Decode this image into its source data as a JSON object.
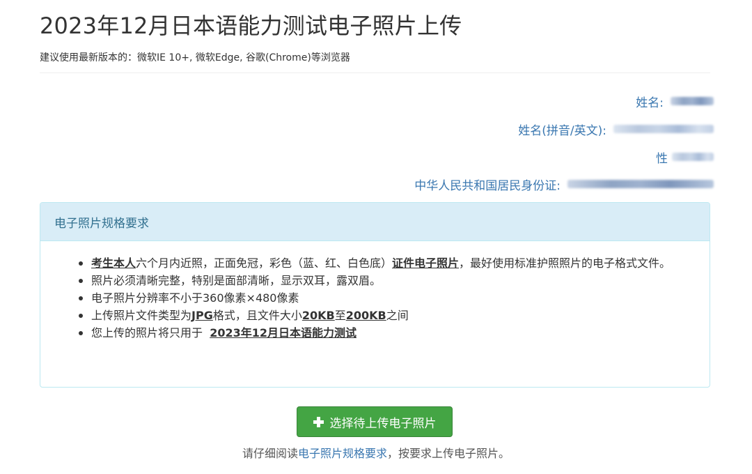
{
  "header": {
    "title": "2023年12月日本语能力测试电子照片上传",
    "browser_note": "建议使用最新版本的：微软IE 10+, 微软Edge, 谷歌(Chrome)等浏览器"
  },
  "info": {
    "name_label": "姓名:",
    "pinyin_label": "姓名(拼音/英文):",
    "gender_label": "性",
    "id_label": "中华人民共和国居民身份证:"
  },
  "panel": {
    "title": "电子照片规格要求",
    "items": [
      {
        "p1_bold": "考生本人",
        "p2": "六个月内近照，正面免冠，彩色（蓝、红、白色底）",
        "p3_bold": "证件电子照片",
        "p4": "，最好使用标准护照照片的电子格式文件。"
      },
      {
        "text": "照片必须清晰完整，特别是面部清晰，显示双耳，露双眉。"
      },
      {
        "text": "电子照片分辨率不小于360像素×480像素"
      },
      {
        "p1": "上传照片文件类型为",
        "p2_bold": "JPG",
        "p3": "格式，且文件大小",
        "p4_bold": "20KB",
        "p5": "至",
        "p6_bold": "200KB",
        "p7": "之间"
      },
      {
        "p1": "您上传的照片将只用于  ",
        "p2_bold": "2023年12月日本语能力测试"
      }
    ]
  },
  "upload": {
    "button_label": "选择待上传电子照片",
    "icon": "plus-icon",
    "hint_prefix": "请仔细阅读",
    "hint_link": "电子照片规格要求",
    "hint_suffix": "，按要求上传电子照片。"
  },
  "colors": {
    "accent_link": "#3a77b0",
    "panel_heading_bg": "#d9edf7",
    "panel_border": "#bce8f1",
    "button_green": "#44a544"
  }
}
